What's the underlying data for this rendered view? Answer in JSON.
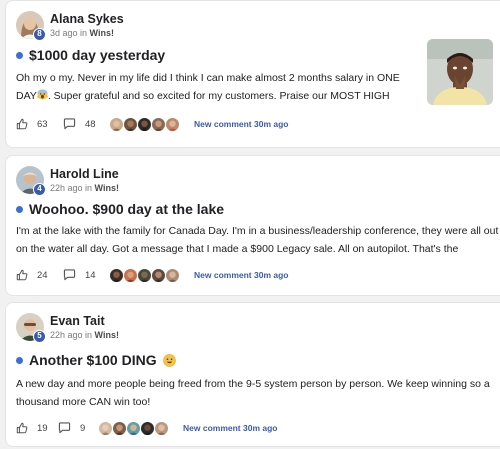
{
  "colors": {
    "accent": "#3b6fd8",
    "badge": "#3b5ba9",
    "link": "#3b5ba9"
  },
  "posts": [
    {
      "author": "Alana Sykes",
      "level": "8",
      "time": "3d ago in ",
      "category": "Wins!",
      "title": "$1000 day yesterday",
      "body_text": "Oh my o my. Never in my life did I think I can make almost 2 months salary in ONE DAY",
      "body_emoji": "scream-emoji-icon",
      "body_text_2": ". Super grateful and so excited for my customers. Praise our MOST HIGH",
      "has_image": true,
      "likes": "63",
      "comments": "48",
      "new_comment": "New comment 30m ago"
    },
    {
      "author": "Harold Line",
      "level": "4",
      "time": "22h ago in ",
      "category": "Wins!",
      "title": "Woohoo. $900 day at the lake",
      "body_text": "I'm at the lake with the family for Canada Day. I'm in a business/leadership conference, they were all out on the water all day. Got a message that I made a $900 Legacy sale. All on autopilot. That's the",
      "likes": "24",
      "comments": "14",
      "new_comment": "New comment 30m ago"
    },
    {
      "author": "Evan Tait",
      "level": "5",
      "time": "22h ago in ",
      "category": "Wins!",
      "title": "Another $100 DING",
      "title_emoji": "smile-emoji-icon",
      "body_text": "A new day and more people being freed from the 9-5 system person by person. We keep winning so a thousand more CAN win too!",
      "likes": "19",
      "comments": "9",
      "new_comment": "New comment 30m ago"
    }
  ]
}
